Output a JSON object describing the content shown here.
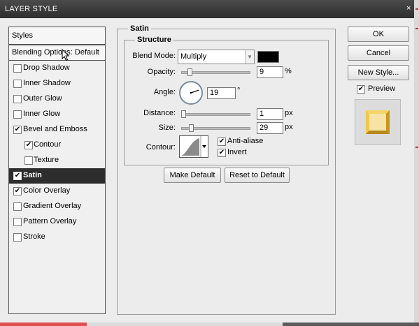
{
  "window": {
    "title": "LAYER STYLE",
    "close_glyph": "×"
  },
  "styles_panel": {
    "header": "Styles",
    "blending_label": "Blending Options: Default",
    "items": [
      {
        "label": "Drop Shadow",
        "checked": false,
        "selected": false,
        "indented": false
      },
      {
        "label": "Inner Shadow",
        "checked": false,
        "selected": false,
        "indented": false
      },
      {
        "label": "Outer Glow",
        "checked": false,
        "selected": false,
        "indented": false
      },
      {
        "label": "Inner Glow",
        "checked": false,
        "selected": false,
        "indented": false
      },
      {
        "label": "Bevel and Emboss",
        "checked": true,
        "selected": false,
        "indented": false
      },
      {
        "label": "Contour",
        "checked": true,
        "selected": false,
        "indented": true
      },
      {
        "label": "Texture",
        "checked": false,
        "selected": false,
        "indented": true
      },
      {
        "label": "Satin",
        "checked": true,
        "selected": true,
        "indented": false
      },
      {
        "label": "Color Overlay",
        "checked": true,
        "selected": false,
        "indented": false
      },
      {
        "label": "Gradient Overlay",
        "checked": false,
        "selected": false,
        "indented": false
      },
      {
        "label": "Pattern Overlay",
        "checked": false,
        "selected": false,
        "indented": false
      },
      {
        "label": "Stroke",
        "checked": false,
        "selected": false,
        "indented": false
      }
    ]
  },
  "satin": {
    "section_title": "Satin",
    "structure_title": "Structure",
    "blend_mode_label": "Blend Mode:",
    "blend_mode_value": "Multiply",
    "blend_color": "#000000",
    "opacity_label": "Opacity:",
    "opacity_value": "9",
    "opacity_unit": "%",
    "opacity_level": 0.09,
    "angle_label": "Angle:",
    "angle_value": "19",
    "angle_unit": "°",
    "distance_label": "Distance:",
    "distance_value": "1",
    "distance_unit": "px",
    "distance_level": 0.004,
    "size_label": "Size:",
    "size_value": "29",
    "size_unit": "px",
    "size_level": 0.116,
    "contour_label": "Contour:",
    "anti_alias_label": "Anti-aliase",
    "anti_alias_checked": true,
    "invert_label": "Invert",
    "invert_checked": true,
    "make_default_label": "Make Default",
    "reset_default_label": "Reset to Default"
  },
  "actions": {
    "ok_label": "OK",
    "cancel_label": "Cancel",
    "new_style_label": "New Style...",
    "preview_label": "Preview",
    "preview_checked": true
  },
  "colors": {
    "selected_row_bg": "#2d2d2d",
    "titlebar": "#3a3a3a",
    "preview_gold": "#e6b830"
  }
}
